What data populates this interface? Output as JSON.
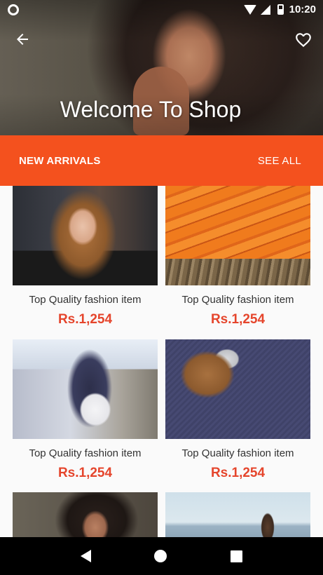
{
  "status_bar": {
    "time": "10:20"
  },
  "hero": {
    "title": "Welcome To Shop"
  },
  "section": {
    "title": "NEW ARRIVALS",
    "see_all_label": "SEE ALL"
  },
  "products": [
    {
      "title": "Top Quality fashion item",
      "price": "Rs.1,254"
    },
    {
      "title": "Top Quality fashion item",
      "price": "Rs.1,254"
    },
    {
      "title": "Top Quality fashion item",
      "price": "Rs.1,254"
    },
    {
      "title": "Top Quality fashion item",
      "price": "Rs.1,254"
    },
    {
      "title": "",
      "price": ""
    },
    {
      "title": "",
      "price": ""
    }
  ],
  "colors": {
    "accent": "#f4511e",
    "price": "#e5452c"
  },
  "icons": {
    "back": "arrow-left-icon",
    "favorite": "heart-outline-icon"
  }
}
